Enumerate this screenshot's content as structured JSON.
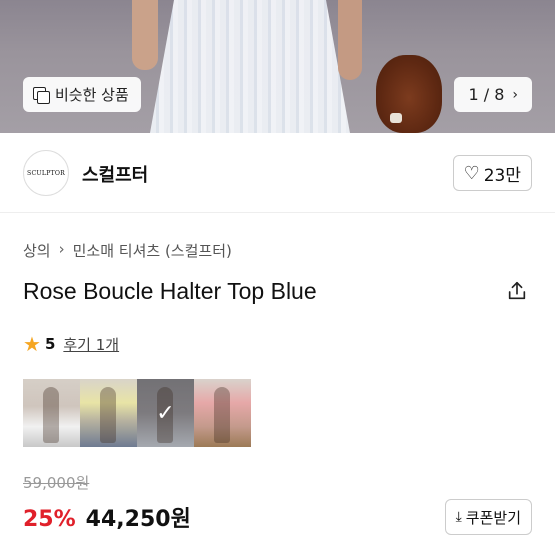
{
  "hero": {
    "similar_label": "비슷한 상품",
    "image_counter": "1 / 8"
  },
  "brand": {
    "logo_text": "SCULPTOR",
    "name": "스컬프터",
    "like_count": "23만"
  },
  "breadcrumb": [
    "상의",
    "민소매 티셔츠 (스컬프터)"
  ],
  "product": {
    "title": "Rose Boucle Halter Top Blue",
    "rating_score": "5",
    "review_label": "후기 1개"
  },
  "thumbnails": [
    {
      "name": "color-option-1",
      "selected": false
    },
    {
      "name": "color-option-2",
      "selected": false
    },
    {
      "name": "color-option-3",
      "selected": true
    },
    {
      "name": "color-option-4",
      "selected": false
    }
  ],
  "price": {
    "original": "59,000원",
    "discount": "25%",
    "final": "44,250원"
  },
  "coupon": {
    "label": "쿠폰받기"
  },
  "colors": {
    "discount": "#e0202a",
    "star": "#f5a623"
  }
}
